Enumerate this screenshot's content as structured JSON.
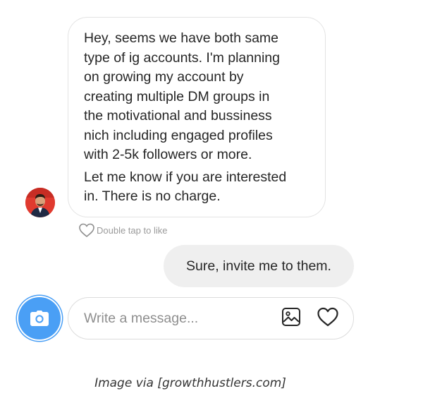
{
  "conversation": {
    "incoming": {
      "paragraph_1": "Hey, seems we have both same\ntype of ig accounts. I'm planning\non growing my  account by\ncreating multiple DM groups in\nthe motivational and bussiness\nnich including engaged profiles\nwith 2-5k followers or more.",
      "paragraph_2": "Let me know if you are interested\nin. There is no charge.",
      "like_hint": "Double tap to like"
    },
    "outgoing": {
      "text": "Sure, invite me to them."
    }
  },
  "composer": {
    "placeholder": "Write a message...",
    "icons": {
      "camera": "camera-icon",
      "gallery": "image-icon",
      "like": "heart-icon"
    }
  },
  "caption": "Image via [growthhustlers.com]",
  "colors": {
    "camera_blue": "#4a9ff5",
    "outgoing_bubble": "#efefef",
    "bubble_border": "#e3e3e3",
    "avatar_red": "#e03a2f"
  }
}
